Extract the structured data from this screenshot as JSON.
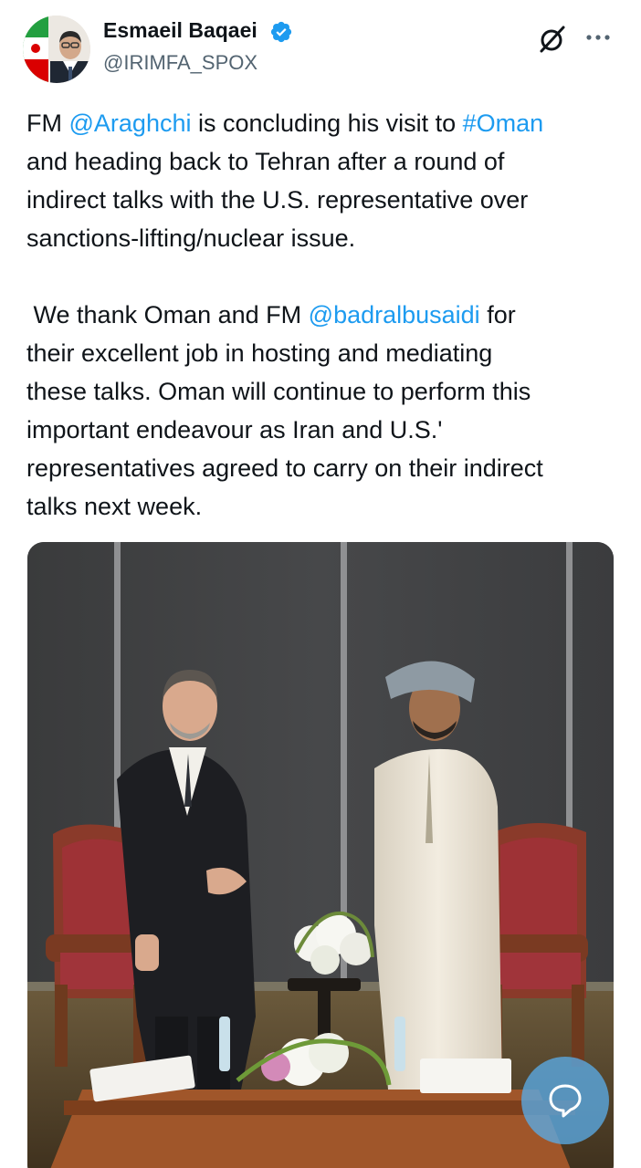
{
  "author": {
    "display_name": "Esmaeil Baqaei",
    "handle": "@IRIMFA_SPOX",
    "verified": true,
    "avatar_icon": "iran-flag-portrait-avatar"
  },
  "toolbar": {
    "grok_icon": "grok-icon",
    "more_icon": "more-dots-icon"
  },
  "tweet": {
    "p1_a": "FM ",
    "mention1": "@Araghchi",
    "p1_b": " is concluding his visit to ",
    "hashtag1": "#Oman",
    "p1_c": "\nand heading back to Tehran after a round of\nindirect talks with the U.S. representative over\nsanctions-lifting/nuclear issue.\n\n We thank Oman and FM ",
    "mention2": "@badralbusaidi",
    "p2_b": " for\ntheir excellent job in hosting and mediating\nthese talks. Oman will continue to perform this\nimportant endeavour as Iran and U.S.'\nrepresentatives agreed to carry on their indirect\ntalks next week."
  },
  "media": {
    "icon": "photo-two-officials-meeting"
  },
  "fab": {
    "icon": "compose-reply-icon"
  },
  "colors": {
    "link": "#1d9bf0",
    "verified": "#1d9bf0",
    "text": "#0f1419",
    "secondary": "#536471"
  }
}
